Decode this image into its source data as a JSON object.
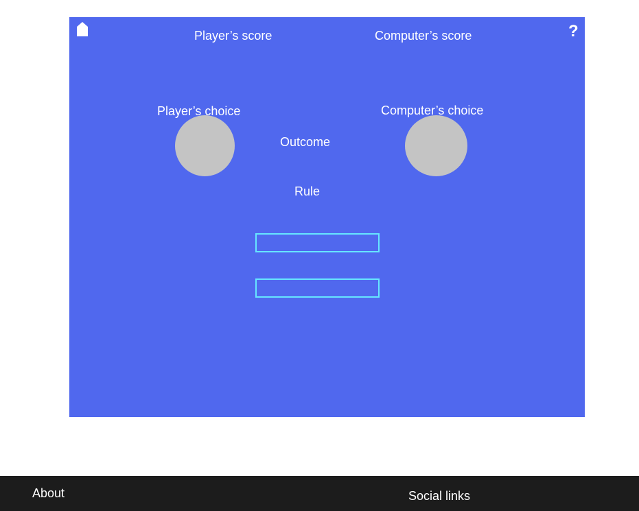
{
  "game": {
    "player_score_label": "Player’s score",
    "computer_score_label": "Computer’s score",
    "player_choice_label": "Player’s choice",
    "computer_choice_label": "Computer’s choice",
    "outcome_label": "Outcome",
    "rule_label": "Rule",
    "help_label": "?"
  },
  "icons": {
    "home": "home-icon",
    "help": "help-icon"
  },
  "colors": {
    "panel_background": "#5068ee",
    "choice_placeholder": "#c4c4c4",
    "button_outline": "#66e6ff",
    "footer_background": "#1c1c1c",
    "text": "#ffffff"
  },
  "footer": {
    "about_label": "About",
    "social_label": "Social links"
  }
}
